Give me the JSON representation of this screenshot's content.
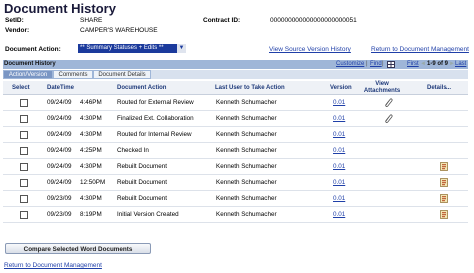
{
  "page": {
    "title": "Document History"
  },
  "fields": {
    "setid_label": "SetID:",
    "setid_value": "SHARE",
    "vendor_label": "Vendor:",
    "vendor_value": "CAMPER'S WAREHOUSE",
    "contract_label": "Contract ID:",
    "contract_value": "000000000000000000000051",
    "action_label": "Document Action:",
    "action_value": "** Summary Statuses + Edits **"
  },
  "links": {
    "view_source": "View Source Version History",
    "return_top": "Return to Document Management",
    "return_bottom": "Return to Document Management"
  },
  "grid": {
    "title": "Document History",
    "customize": "Customize",
    "find": "Find",
    "first": "First",
    "range": "1-9 of 9",
    "last": "Last",
    "tabs": [
      "Action/Version",
      "Comments",
      "Document Details"
    ],
    "headers": {
      "select": "Select",
      "datetime": "DateTime",
      "action": "Document Action",
      "user": "Last User to Take Action",
      "version": "Version",
      "attachments": "View Attachments",
      "details": "Details"
    },
    "rows": [
      {
        "date": "09/24/09",
        "time": "4:46PM",
        "action": "Routed for External Review",
        "user": "Kenneth Schumacher",
        "version": "0.01",
        "attach": true,
        "details": false
      },
      {
        "date": "09/24/09",
        "time": "4:30PM",
        "action": "Finalized Ext. Collaboration",
        "user": "Kenneth Schumacher",
        "version": "0.01",
        "attach": true,
        "details": false
      },
      {
        "date": "09/24/09",
        "time": "4:30PM",
        "action": "Routed for Internal Review",
        "user": "Kenneth Schumacher",
        "version": "0.01",
        "attach": false,
        "details": false
      },
      {
        "date": "09/24/09",
        "time": "4:25PM",
        "action": "Checked In",
        "user": "Kenneth Schumacher",
        "version": "0.01",
        "attach": false,
        "details": false
      },
      {
        "date": "09/24/09",
        "time": "4:30PM",
        "action": "Rebuilt Document",
        "user": "Kenneth Schumacher",
        "version": "0.01",
        "attach": false,
        "details": true
      },
      {
        "date": "09/24/09",
        "time": "12:50PM",
        "action": "Rebuilt Document",
        "user": "Kenneth Schumacher",
        "version": "0.01",
        "attach": false,
        "details": true
      },
      {
        "date": "09/23/09",
        "time": "4:30PM",
        "action": "Rebuilt Document",
        "user": "Kenneth Schumacher",
        "version": "0.01",
        "attach": false,
        "details": true
      },
      {
        "date": "09/23/09",
        "time": "8:19PM",
        "action": "Initial Version Created",
        "user": "Kenneth Schumacher",
        "version": "0.01",
        "attach": false,
        "details": true
      }
    ]
  },
  "buttons": {
    "compare": "Compare Selected Word Documents"
  }
}
